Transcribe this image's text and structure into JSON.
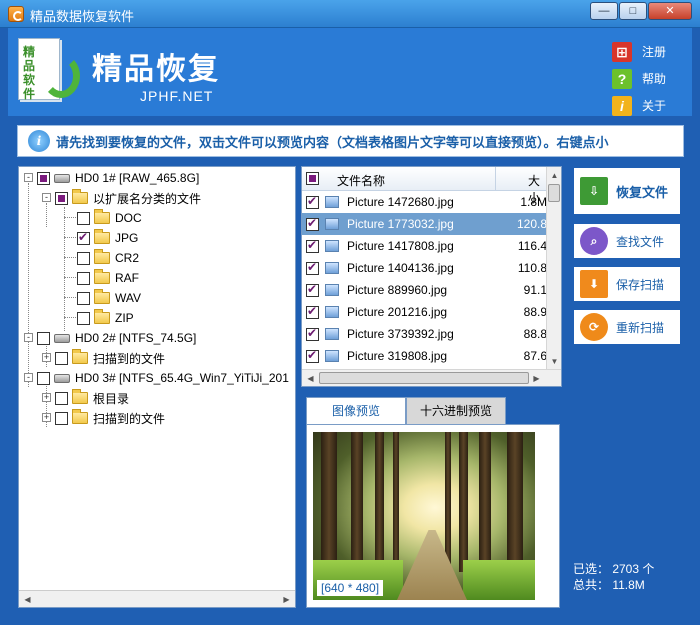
{
  "window": {
    "title": "精品数据恢复软件",
    "minimize": "—",
    "maximize": "□",
    "close": "✕"
  },
  "header": {
    "logo_text": "精品软件",
    "brand": "精品恢复",
    "url": "JPHF.NET",
    "links": [
      {
        "label": "注册",
        "icon": "cart-icon"
      },
      {
        "label": "帮助",
        "icon": "help-icon"
      },
      {
        "label": "关于",
        "icon": "info-icon"
      }
    ]
  },
  "notice": {
    "icon": "i",
    "text": "请先找到要恢复的文件，双击文件可以预览内容（文档表格图片文字等可以直接预览）。右键点小"
  },
  "tree": {
    "nodes": [
      {
        "label": "HD0    1# [RAW_465.8G]",
        "state": "partial",
        "type": "disk",
        "expander": "-"
      },
      {
        "label": "以扩展名分类的文件",
        "state": "partial",
        "type": "folder",
        "expander": "-"
      },
      {
        "label": "DOC",
        "state": "empty",
        "type": "folder"
      },
      {
        "label": "JPG",
        "state": "checked",
        "type": "folder"
      },
      {
        "label": "CR2",
        "state": "empty",
        "type": "folder"
      },
      {
        "label": "RAF",
        "state": "empty",
        "type": "folder"
      },
      {
        "label": "WAV",
        "state": "empty",
        "type": "folder"
      },
      {
        "label": "ZIP",
        "state": "empty",
        "type": "folder"
      },
      {
        "label": "HD0    2# [NTFS_74.5G]",
        "state": "empty",
        "type": "disk",
        "expander": "-"
      },
      {
        "label": "扫描到的文件",
        "state": "empty",
        "type": "folder",
        "expander": "+"
      },
      {
        "label": "HD0    3# [NTFS_65.4G_Win7_YiTiJi_201",
        "state": "empty",
        "type": "disk",
        "expander": "-"
      },
      {
        "label": "根目录",
        "state": "empty",
        "type": "folder",
        "expander": "+"
      },
      {
        "label": "扫描到的文件",
        "state": "empty",
        "type": "folder",
        "expander": "+"
      }
    ]
  },
  "filelist": {
    "columns": {
      "name": "文件名称",
      "size": "大小"
    },
    "rows": [
      {
        "name": "Picture 1472680.jpg",
        "size": "1.8M",
        "selected": false
      },
      {
        "name": "Picture 1773032.jpg",
        "size": "120.8",
        "selected": true
      },
      {
        "name": "Picture 1417808.jpg",
        "size": "116.4",
        "selected": false
      },
      {
        "name": "Picture 1404136.jpg",
        "size": "110.8",
        "selected": false
      },
      {
        "name": "Picture 889960.jpg",
        "size": "91.1",
        "selected": false
      },
      {
        "name": "Picture 201216.jpg",
        "size": "88.9",
        "selected": false
      },
      {
        "name": "Picture 3739392.jpg",
        "size": "88.8",
        "selected": false
      },
      {
        "name": "Picture 319808.jpg",
        "size": "87.6",
        "selected": false
      }
    ]
  },
  "preview": {
    "tabs": [
      "图像预览",
      "十六进制预览"
    ],
    "active_tab": 0,
    "dimensions": "[640 * 480]"
  },
  "actions": {
    "recover": "恢复文件",
    "find": "查找文件",
    "save_scan": "保存扫描",
    "rescan": "重新扫描"
  },
  "stats": {
    "selected": "已选：  2703 个",
    "total": "总共：  11.8M"
  },
  "colors": {
    "frame": "#1f5fb3",
    "header": "#2a7bd6",
    "selection": "#6f9fcf",
    "accent_text": "#1a5fa8"
  }
}
